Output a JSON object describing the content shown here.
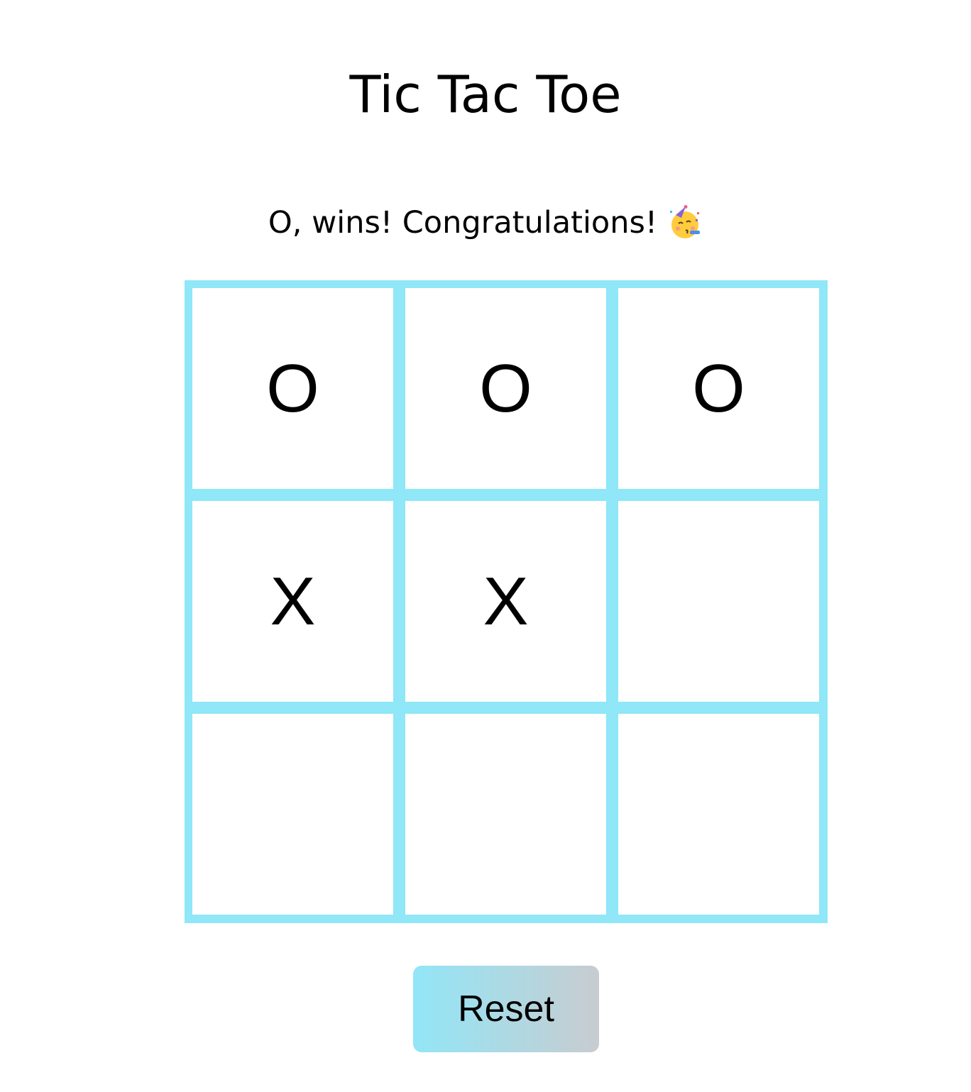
{
  "title": "Tic Tac Toe",
  "status": {
    "message": "O, wins! Congratulations!",
    "emoji_icon": "partying-face-icon"
  },
  "board": {
    "cells": [
      "O",
      "O",
      "O",
      "X",
      "X",
      "",
      "",
      "",
      ""
    ]
  },
  "reset_label": "Reset",
  "colors": {
    "board_border": "#8fe7f7",
    "reset_gradient_start": "#92e6f7",
    "reset_gradient_end": "#c8ccd0"
  }
}
